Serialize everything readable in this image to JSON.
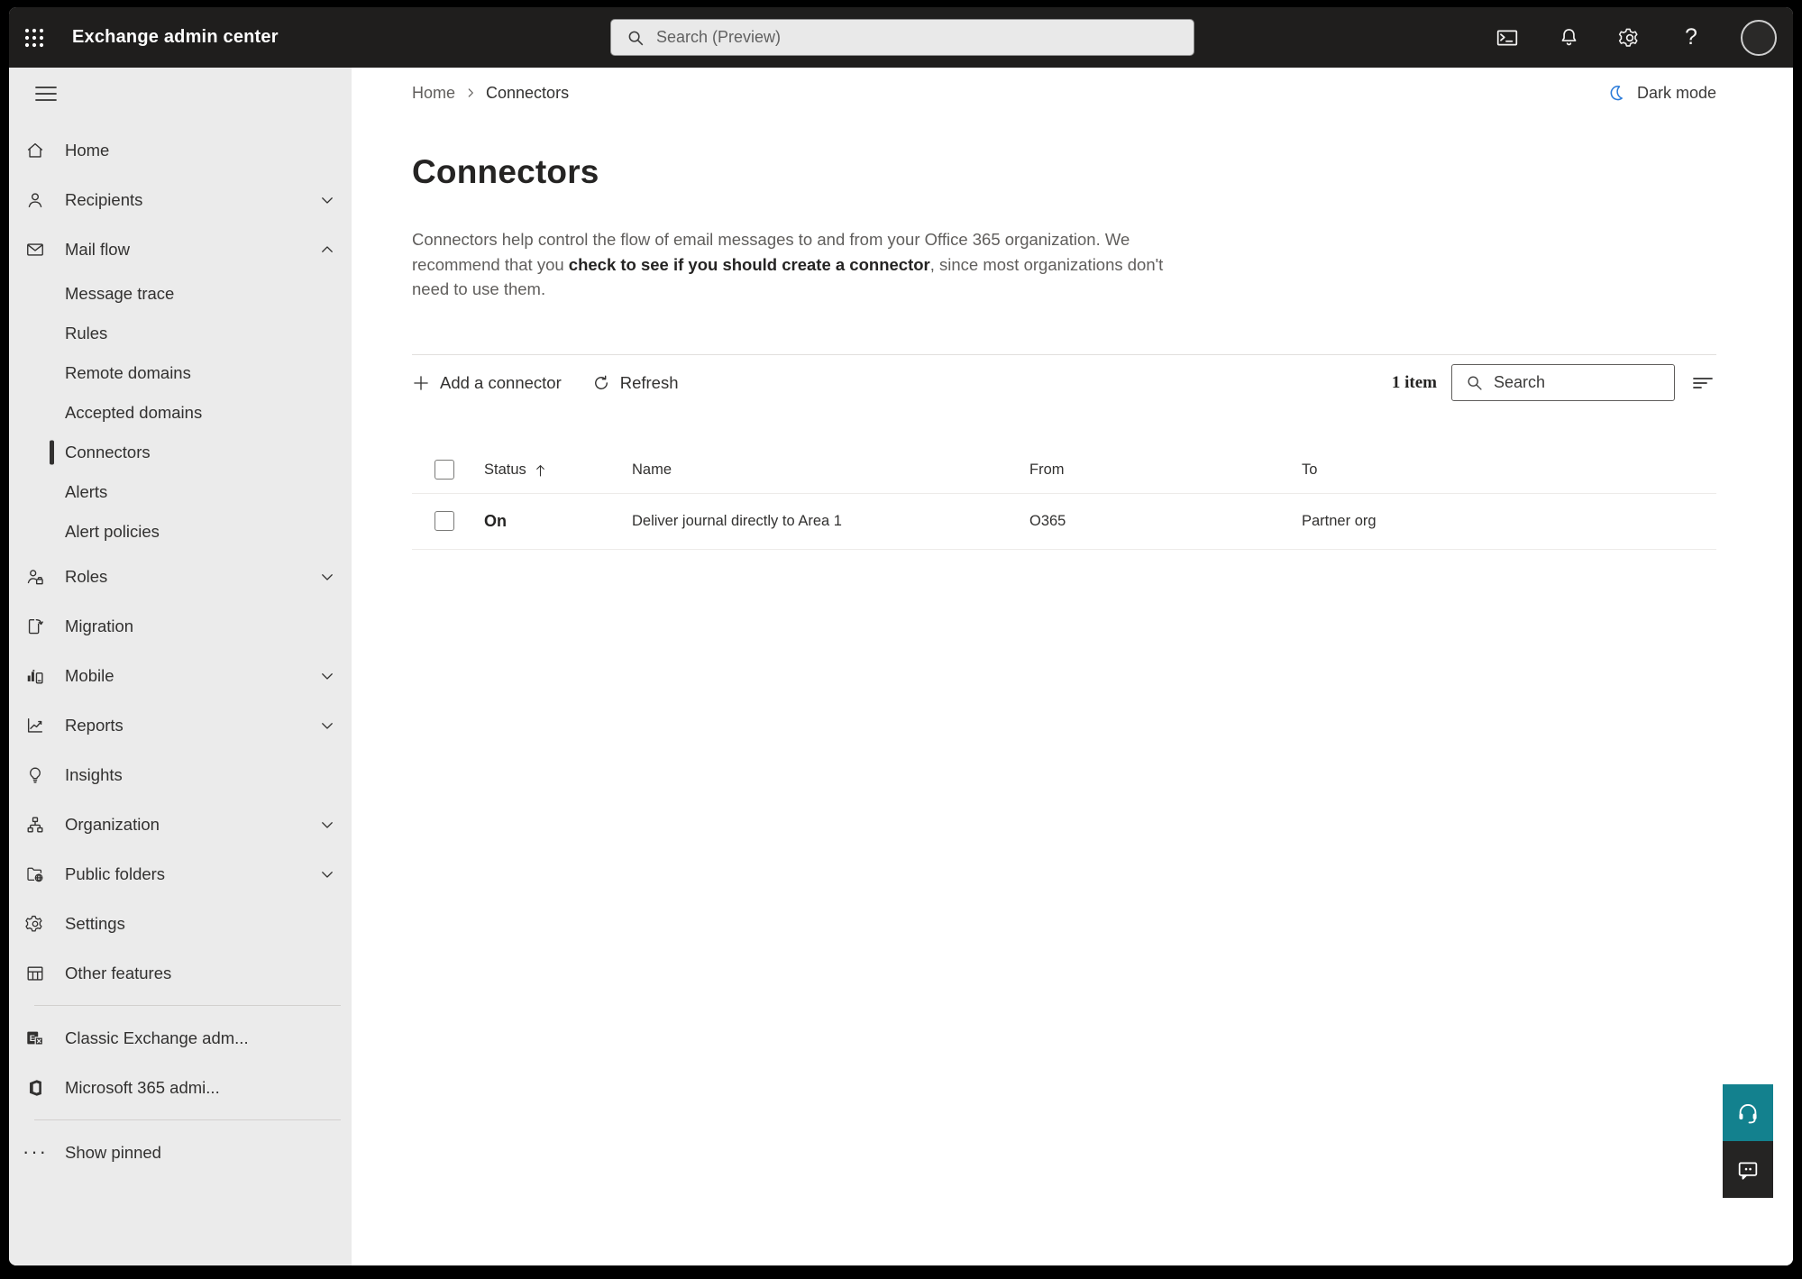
{
  "colors": {
    "topbar_bg": "#1f1e1d",
    "sidebar_bg": "#ebebeb",
    "accent_teal": "#13818e",
    "feedback_dark": "#252423",
    "moon_blue": "#2b7bd9",
    "text_primary": "#323130",
    "text_muted": "#605e5c"
  },
  "topbar": {
    "title": "Exchange admin center",
    "search_placeholder": "Search (Preview)",
    "icons": [
      "waffle-icon",
      "cloud-shell-icon",
      "notifications-bell-icon",
      "settings-gear-icon",
      "help-icon",
      "avatar"
    ]
  },
  "sidebar": {
    "home": "Home",
    "recipients": "Recipients",
    "mail_flow": "Mail flow",
    "message_trace": "Message trace",
    "rules": "Rules",
    "remote_domains": "Remote domains",
    "accepted_domains": "Accepted domains",
    "connectors": "Connectors",
    "alerts": "Alerts",
    "alert_policies": "Alert policies",
    "roles": "Roles",
    "migration": "Migration",
    "mobile": "Mobile",
    "reports": "Reports",
    "insights": "Insights",
    "organization": "Organization",
    "public_folders": "Public folders",
    "settings": "Settings",
    "other_features": "Other features",
    "classic_exchange": "Classic Exchange adm...",
    "microsoft_365": "Microsoft 365 admi...",
    "show_pinned": "Show pinned",
    "selected_item": "Connectors"
  },
  "main": {
    "breadcrumb": {
      "home": "Home",
      "current": "Connectors"
    },
    "dark_mode_label": "Dark mode",
    "title": "Connectors",
    "description_part1": "Connectors help control the flow of email messages to and from your Office 365 organization. We recommend that you ",
    "description_strong": "check to see if you should create a connector",
    "description_part2": ", since most organizations don't need to use them.",
    "toolbar": {
      "add_label": "Add a connector",
      "refresh_label": "Refresh",
      "item_count": "1 item",
      "search_placeholder": "Search"
    },
    "table": {
      "headers": {
        "status": "Status",
        "name": "Name",
        "from": "From",
        "to": "To"
      },
      "sort": {
        "column": "Status",
        "direction": "ascending"
      },
      "rows": [
        {
          "status": "On",
          "name": "Deliver journal directly to Area 1",
          "from": "O365",
          "to": "Partner org"
        }
      ]
    }
  }
}
